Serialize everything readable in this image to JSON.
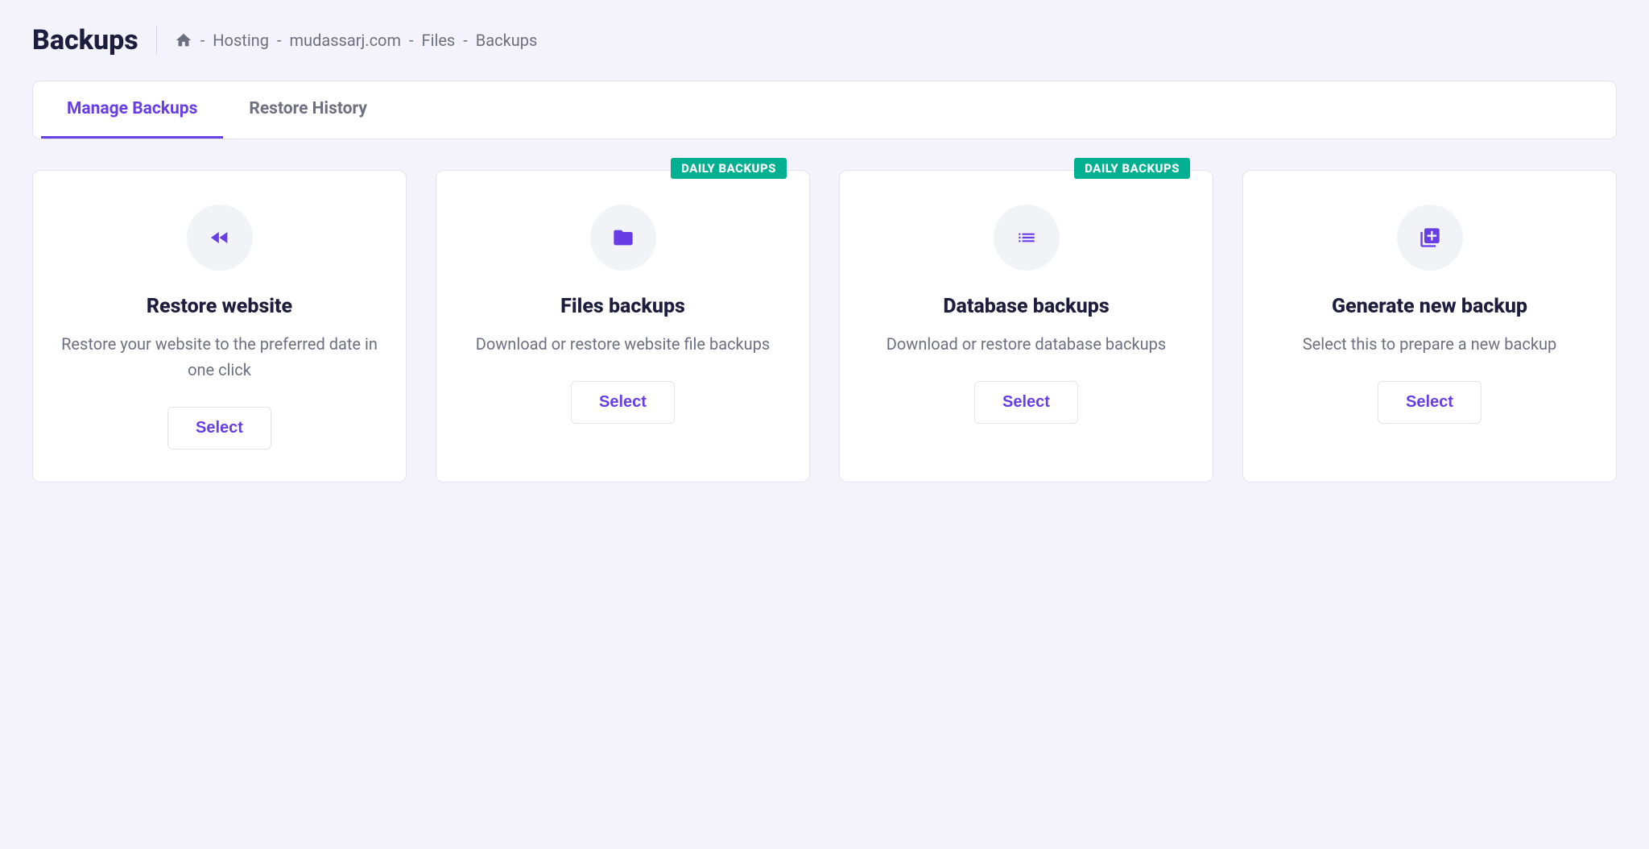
{
  "page": {
    "title": "Backups"
  },
  "breadcrumb": {
    "items": [
      {
        "label": "Hosting"
      },
      {
        "label": "mudassarj.com"
      },
      {
        "label": "Files"
      },
      {
        "label": "Backups"
      }
    ],
    "separator": "-"
  },
  "tabs": [
    {
      "label": "Manage Backups",
      "active": true
    },
    {
      "label": "Restore History",
      "active": false
    }
  ],
  "badges": {
    "daily": "DAILY BACKUPS"
  },
  "cards": [
    {
      "icon": "rewind-icon",
      "title": "Restore website",
      "desc": "Restore your website to the preferred date in one click",
      "button": "Select",
      "badge": null
    },
    {
      "icon": "folder-icon",
      "title": "Files backups",
      "desc": "Download or restore website file backups",
      "button": "Select",
      "badge": "DAILY BACKUPS"
    },
    {
      "icon": "list-icon",
      "title": "Database backups",
      "desc": "Download or restore database backups",
      "button": "Select",
      "badge": "DAILY BACKUPS"
    },
    {
      "icon": "add-file-icon",
      "title": "Generate new backup",
      "desc": "Select this to prepare a new backup",
      "button": "Select",
      "badge": null
    }
  ]
}
